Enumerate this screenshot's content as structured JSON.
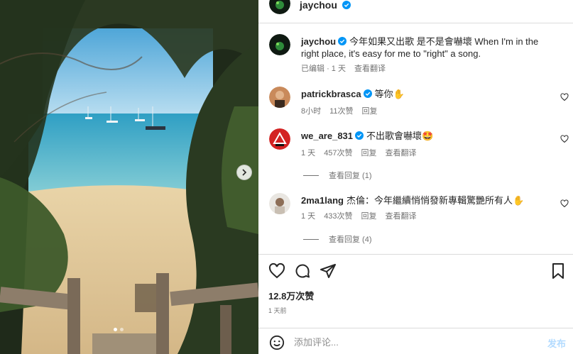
{
  "post": {
    "username": "jaychou",
    "caption": "今年如果又出歌 是不是會嚇壞 When I'm in the right place, it's easy for me to \"right\" a song.",
    "caption_meta": {
      "edited": "已编辑",
      "time": "· 1 天",
      "translate": "查看翻译"
    }
  },
  "comments": [
    {
      "username": "patrickbrasca",
      "verified": true,
      "text": "等你✋",
      "time": "8小时",
      "likes": "11次赞",
      "reply": "回复"
    },
    {
      "username": "we_are_831",
      "verified": true,
      "text": "不出歌會嚇壞🤩",
      "time": "1 天",
      "likes": "457次赞",
      "reply": "回复",
      "translate": "查看翻译",
      "view_replies": "查看回复 (1)"
    },
    {
      "username": "2ma1lang",
      "verified": false,
      "text": "杰倫：今年繼續悄悄發新專輯驚艷所有人✋",
      "time": "1 天",
      "likes": "433次赞",
      "reply": "回复",
      "translate": "查看翻译",
      "view_replies": "查看回复 (4)"
    }
  ],
  "stats": {
    "likes": "12.8万次赞",
    "posted": "1 天前"
  },
  "composer": {
    "placeholder": "添加评论...",
    "post_label": "发布"
  },
  "colors": {
    "verified": "#0095f6",
    "text": "#262626",
    "muted": "#737373",
    "post_button": "#b3dbff"
  }
}
